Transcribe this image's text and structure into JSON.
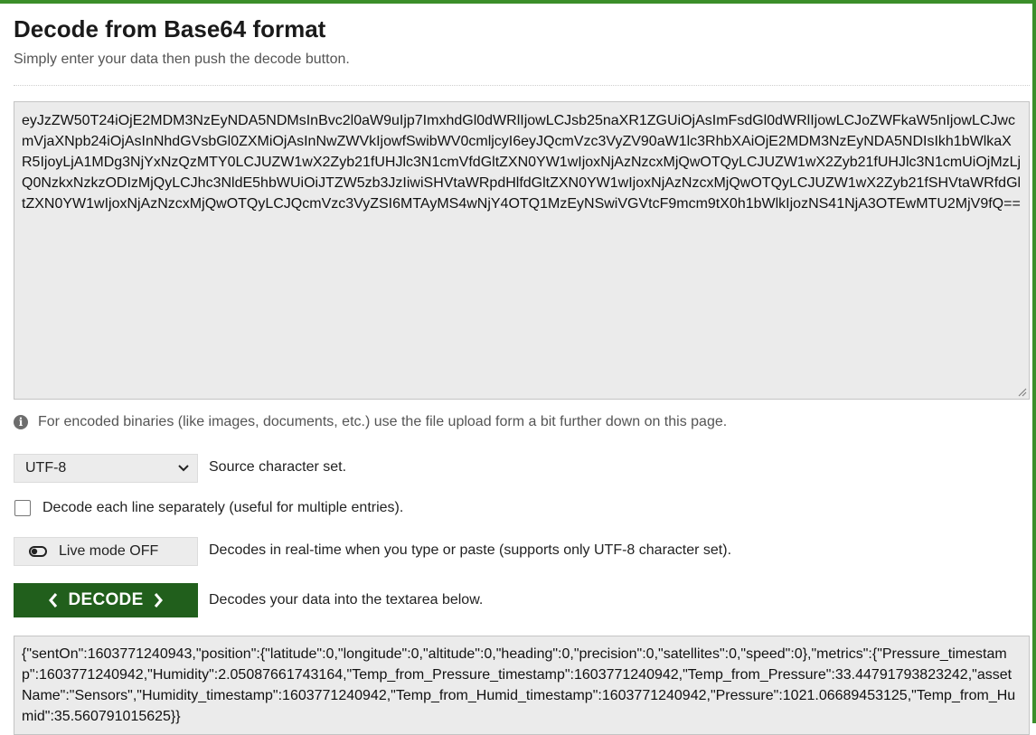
{
  "header": {
    "title": "Decode from Base64 format",
    "subtitle": "Simply enter your data then push the decode button."
  },
  "input": {
    "value": "eyJzZW50T24iOjE2MDM3NzEyNDA5NDMsInBvc2l0aW9uIjp7ImxhdGl0dWRlIjowLCJsb25naXR1ZGUiOjAsImFsdGl0dWRlIjowLCJoZWFkaW5nIjowLCJwcmVjaXNpb24iOjAsInNhdGVsbGl0ZXMiOjAsInNwZWVkIjowfSwibWV0cmljcyI6eyJQcmVzc3VyZV90aW1lc3RhbXAiOjE2MDM3NzEyNDA5NDIsIkh1bWlkaXR5IjoyLjA1MDg3NjYxNzQzMTY0LCJUZW1wX2Zyb21fUHJlc3N1cmVfdGltZXN0YW1wIjoxNjAzNzcxMjQwOTQyLCJUZW1wX2Zyb21fUHJlc3N1cmUiOjMzLjQ0NzkxNzkzODIzMjQyLCJhc3NldE5hbWUiOiJTZW5zb3JzIiwiSHVtaWRpdHlfdGltZXN0YW1wIjoxNjAzNzcxMjQwOTQyLCJUZW1wX2Zyb21fSHVtaWRfdGltZXN0YW1wIjoxNjAzNzcxMjQwOTQyLCJQcmVzc3VyZSI6MTAyMS4wNjY4OTQ1MzEyNSwiVGVtcF9mcm9tX0h1bWlkIjozNS41NjA3OTEwMTU2MjV9fQ=="
  },
  "info": {
    "text": "For encoded binaries (like images, documents, etc.) use the file upload form a bit further down on this page."
  },
  "charset": {
    "selected": "UTF-8",
    "label": "Source character set."
  },
  "line_option": {
    "label": "Decode each line separately (useful for multiple entries).",
    "checked": false
  },
  "live_mode": {
    "button": "Live mode OFF",
    "label": "Decodes in real-time when you type or paste (supports only UTF-8 character set)."
  },
  "decode": {
    "button": "DECODE",
    "label": "Decodes your data into the textarea below."
  },
  "output": {
    "value": "{\"sentOn\":1603771240943,\"position\":{\"latitude\":0,\"longitude\":0,\"altitude\":0,\"heading\":0,\"precision\":0,\"satellites\":0,\"speed\":0},\"metrics\":{\"Pressure_timestamp\":1603771240942,\"Humidity\":2.05087661743164,\"Temp_from_Pressure_timestamp\":1603771240942,\"Temp_from_Pressure\":33.44791793823242,\"assetName\":\"Sensors\",\"Humidity_timestamp\":1603771240942,\"Temp_from_Humid_timestamp\":1603771240942,\"Pressure\":1021.06689453125,\"Temp_from_Humid\":35.560791015625}}"
  },
  "colors": {
    "accent_green": "#3b8e2a",
    "decode_button": "#215f1c",
    "field_bg": "#ebebeb"
  },
  "icons": {
    "info": "info-icon",
    "chevron": "chevron-down-icon",
    "toggle": "toggle-off-icon",
    "left": "chevron-left-icon",
    "right": "chevron-right-icon"
  }
}
